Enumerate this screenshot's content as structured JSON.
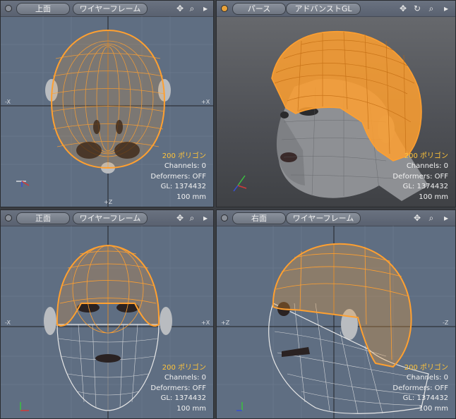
{
  "accent_color": "#ffa030",
  "viewports": {
    "top": {
      "view_label": "上面",
      "mode_label": "ワイヤーフレーム",
      "axis_labels": {
        "left": "-X",
        "right": "+X",
        "bottom": "+Z"
      },
      "polygons": "200 ポリゴン",
      "channels": "Channels: 0",
      "deformers": "Deformers: OFF",
      "gl": "GL: 1374432",
      "scale": "100 mm"
    },
    "persp": {
      "view_label": "パース",
      "mode_label": "アドバンストGL",
      "polygons": "200 ポリゴン",
      "channels": "Channels: 0",
      "deformers": "Deformers: OFF",
      "gl": "GL: 1374432",
      "scale": "100 mm"
    },
    "front": {
      "view_label": "正面",
      "mode_label": "ワイヤーフレーム",
      "axis_labels": {
        "left": "-X",
        "right": "+X"
      },
      "polygons": "200 ポリゴン",
      "channels": "Channels: 0",
      "deformers": "Deformers: OFF",
      "gl": "GL: 1374432",
      "scale": "100 mm"
    },
    "right": {
      "view_label": "右面",
      "mode_label": "ワイヤーフレーム",
      "axis_labels": {
        "left": "+Z",
        "right": "-Z"
      },
      "polygons": "200 ポリゴン",
      "channels": "Channels: 0",
      "deformers": "Deformers: OFF",
      "gl": "GL: 1374432",
      "scale": "100 mm"
    }
  },
  "icons": [
    "move-icon",
    "zoom-icon",
    "rotate-icon",
    "expand-arrow-icon"
  ]
}
